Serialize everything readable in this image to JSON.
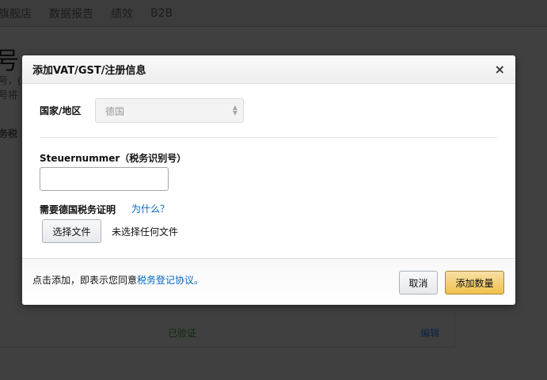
{
  "background": {
    "nav": [
      "旗舰店",
      "数据报告",
      "绩效",
      "B2B"
    ],
    "title": "号",
    "lines": [
      "号，(",
      "号将",
      "务税"
    ],
    "row": {
      "status": "已验证",
      "edit": "编辑"
    }
  },
  "modal": {
    "title": "添加VAT/GST/注册信息",
    "close": "×",
    "country_label": "国家/地区",
    "country_value": "德国",
    "tax_label": "Steuernummer（税务识别号）",
    "tax_value": "",
    "cert_label": "需要德国税务证明",
    "why_link": "为什么？",
    "file_button": "选择文件",
    "no_file": "未选择任何文件",
    "agree_prefix": "点击添加，即表示您同意",
    "agree_link": "税务登记协议。",
    "cancel": "取消",
    "add": "添加数量"
  }
}
